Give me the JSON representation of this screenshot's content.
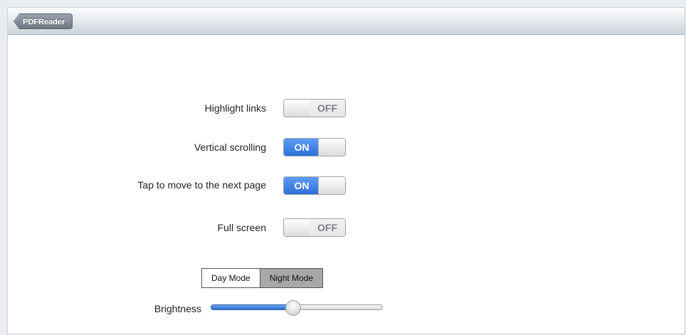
{
  "navbar": {
    "back_label": "PDFReader"
  },
  "settings": [
    {
      "label": "Highlight links",
      "state": "OFF"
    },
    {
      "label": "Vertical scrolling",
      "state": "ON"
    },
    {
      "label": "Tap to move to the next page",
      "state": "ON"
    },
    {
      "label": "Full screen",
      "state": "OFF"
    }
  ],
  "mode": {
    "day_label": "Day Mode",
    "night_label": "Night Mode",
    "selected": "Night Mode"
  },
  "brightness": {
    "label": "Brightness",
    "value": 0.48
  },
  "colors": {
    "accent": "#2d6fd9",
    "selected_segment": "#a8a8a8"
  }
}
